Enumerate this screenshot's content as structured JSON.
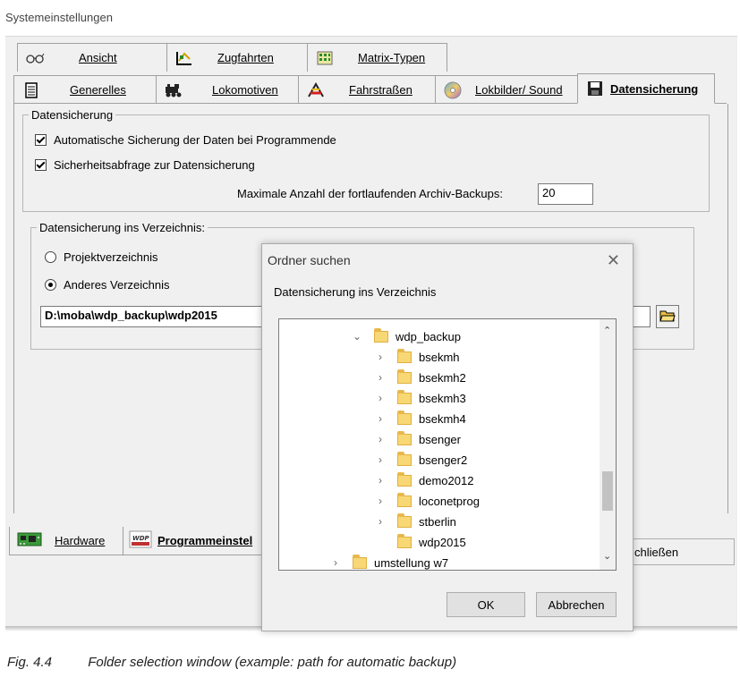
{
  "window": {
    "title": "Systemeinstellungen"
  },
  "tabs_row1": [
    {
      "label": "Ansicht",
      "icon": "glasses-icon"
    },
    {
      "label": "Zugfahrten",
      "icon": "zugfahrten-icon"
    },
    {
      "label": "Matrix-Typen",
      "icon": "matrix-grid-icon"
    }
  ],
  "tabs_row2": [
    {
      "label": "Generelles",
      "icon": "document-icon"
    },
    {
      "label": "Lokomotiven",
      "icon": "locomotive-icon"
    },
    {
      "label": "Fahrstraßen",
      "icon": "route-icon"
    },
    {
      "label": "Lokbilder/ Sound",
      "icon": "cd-icon"
    },
    {
      "label": "Datensicherung",
      "icon": "floppy-disk-icon",
      "active": true
    }
  ],
  "datensicherung": {
    "group_title": "Datensicherung",
    "check_auto": "Automatische Sicherung der Daten bei Programmende",
    "check_query": "Sicherheitsabfrage zur Datensicherung",
    "max_label": "Maximale Anzahl der fortlaufenden Archiv-Backups:",
    "max_value": "20",
    "dir_group_title": "Datensicherung ins Verzeichnis:",
    "radio_project": "Projektverzeichnis",
    "radio_other": "Anderes Verzeichnis",
    "path_value": "D:\\moba\\wdp_backup\\wdp2015"
  },
  "bottom_tabs": [
    {
      "label": "Hardware",
      "icon": "hardware-board-icon"
    },
    {
      "label": "Programmeinstel",
      "icon": "wdp-icon"
    }
  ],
  "close_button": {
    "label": "chließen"
  },
  "dialog": {
    "title": "Ordner suchen",
    "description": "Datensicherung ins Verzeichnis",
    "tree": [
      {
        "label": "wdp_backup",
        "expanded": true,
        "level": 0
      },
      {
        "label": "bsekmh",
        "level": 1
      },
      {
        "label": "bsekmh2",
        "level": 1
      },
      {
        "label": "bsekmh3",
        "level": 1
      },
      {
        "label": "bsekmh4",
        "level": 1
      },
      {
        "label": "bsenger",
        "level": 1
      },
      {
        "label": "bsenger2",
        "level": 1
      },
      {
        "label": "demo2012",
        "level": 1
      },
      {
        "label": "loconetprog",
        "level": 1
      },
      {
        "label": "stberlin",
        "level": 1
      },
      {
        "label": "wdp2015",
        "level": 1,
        "no_chevron": true
      },
      {
        "label": "umstellung w7",
        "level": -1
      }
    ],
    "ok_label": "OK",
    "cancel_label": "Abbrechen"
  },
  "caption": {
    "fig": "Fig. 4.4",
    "text": "Folder selection window (example: path for automatic backup)"
  }
}
